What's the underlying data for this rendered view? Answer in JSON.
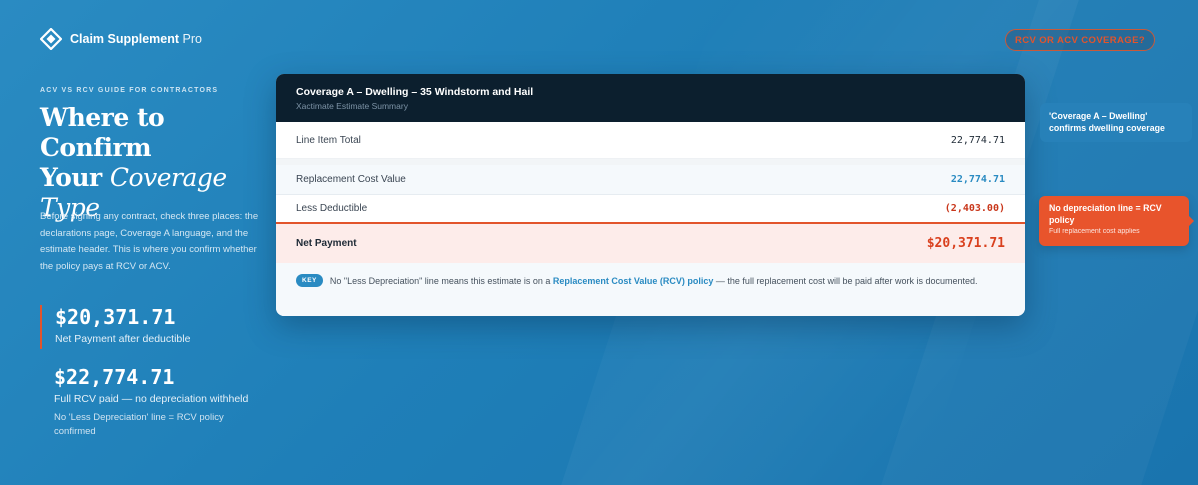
{
  "brand": {
    "name": "Claim Supplement",
    "suffix": " Pro"
  },
  "top_badge": "RCV OR ACV COVERAGE?",
  "left": {
    "eyebrow": "ACV VS RCV GUIDE FOR CONTRACTORS",
    "headline_line1": "Where to Confirm",
    "headline_line2_a": "Your ",
    "headline_line2_em": "Coverage",
    "headline_line3_em": "Type",
    "intro": "Before signing any contract, check three places: the declarations page, Coverage A language, and the estimate header. This is where you confirm whether the policy pays at RCV or ACV.",
    "stat1": {
      "value": "$20,371.71",
      "label": "Net Payment after deductible"
    },
    "stat2": {
      "value": "$22,774.71",
      "label": "Full RCV paid — no depreciation withheld",
      "note": "No 'Less Depreciation' line = RCV policy confirmed"
    }
  },
  "card": {
    "title": "Coverage A – Dwelling – 35 Windstorm and Hail",
    "subtitle": "Xactimate Estimate Summary",
    "rows": {
      "total": {
        "label": "Line Item Total",
        "value": "22,774.71"
      },
      "rcv": {
        "label": "Replacement Cost Value",
        "value": "22,774.71"
      },
      "deductible": {
        "label": "Less Deductible",
        "value": "(2,403.00)"
      },
      "net": {
        "label": "Net Payment",
        "value": "$20,371.71"
      }
    },
    "footer": {
      "key_label": "KEY",
      "text_before": "No \"Less Depreciation\" line means this estimate is on a ",
      "highlight": "Replacement Cost Value (RCV) policy",
      "text_after": " — the full replacement cost will be paid after work is documented."
    }
  },
  "callouts": {
    "dwelling": "'Coverage A – Dwelling' confirms dwelling coverage",
    "rcv_title": "No depreciation line = RCV policy",
    "rcv_sub": "Full replacement cost applies"
  },
  "colors": {
    "background": "#1f7fb8",
    "accent_orange": "#e2542c",
    "accent_blue": "#2a8bc2",
    "card_header": "#0c1f2e"
  }
}
